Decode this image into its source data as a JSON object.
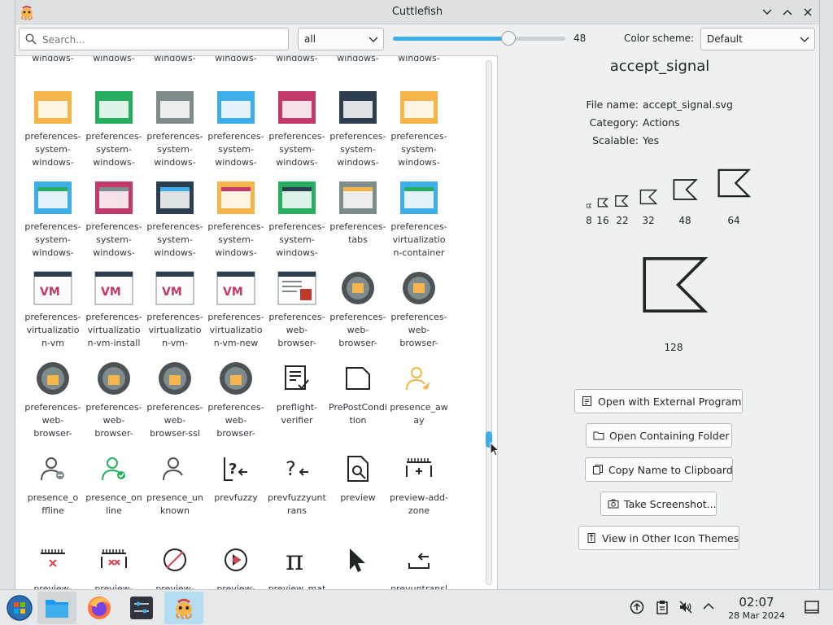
{
  "window": {
    "title": "Cuttlefish"
  },
  "toolbar": {
    "search_placeholder": "Search...",
    "filter_value": "all",
    "zoom_value": "48",
    "zoom_fraction": 0.67,
    "color_scheme_label": "Color scheme:",
    "color_scheme_value": "Default"
  },
  "grid": {
    "rows": [
      [
        "system-\nwindows-",
        "system-\nwindows-",
        "system-\nwindows-",
        "system-\nwindows-",
        "system-\nwindows-",
        "system-\nwindows-",
        "system-\nwindows-"
      ],
      [
        "preferences-\nsystem-\nwindows-",
        "preferences-\nsystem-\nwindows-",
        "preferences-\nsystem-\nwindows-",
        "preferences-\nsystem-\nwindows-",
        "preferences-\nsystem-\nwindows-",
        "preferences-\nsystem-\nwindows-",
        "preferences-\nsystem-\nwindows-"
      ],
      [
        "preferences-\nsystem-\nwindows-",
        "preferences-\nsystem-\nwindows-",
        "preferences-\nsystem-\nwindows-",
        "preferences-\nsystem-\nwindows-",
        "preferences-\nsystem-\nwindows-",
        "preferences-\ntabs",
        "preferences-\nvirtualizatio\nn-container"
      ],
      [
        "preferences-\nvirtualizatio\nn-vm",
        "preferences-\nvirtualizatio\nn-vm-install",
        "preferences-\nvirtualizatio\nn-vm-",
        "preferences-\nvirtualizatio\nn-vm-new",
        "preferences-\nweb-\nbrowser-",
        "preferences-\nweb-\nbrowser-",
        "preferences-\nweb-\nbrowser-"
      ],
      [
        "preferences-\nweb-\nbrowser-",
        "preferences-\nweb-\nbrowser-",
        "preferences-\nweb-\nbrowser-ssl",
        "preferences-\nweb-\nbrowser-",
        "preflight-\nverifier",
        "PrePostCondi\ntion",
        "presence_aw\nay"
      ],
      [
        "presence_o\nffline",
        "presence_on\nline",
        "presence_un\nknown",
        "prevfuzzy",
        "prevfuzzyunt\nrans",
        "preview",
        "preview-add-\nzone"
      ],
      [
        "preview-",
        "preview-",
        "preview-",
        "preview-",
        "preview_mat",
        "",
        "prevuntransl"
      ]
    ]
  },
  "details": {
    "icon_name": "accept_signal",
    "file_name_label": "File name:",
    "file_name_value": "accept_signal.svg",
    "category_label": "Category:",
    "category_value": "Actions",
    "scalable_label": "Scalable:",
    "scalable_value": "Yes",
    "sizes": [
      "8",
      "16",
      "22",
      "32",
      "48",
      "64",
      "128"
    ],
    "buttons": {
      "open_external": "Open with External Program",
      "open_folder": "Open Containing Folder",
      "copy_name": "Copy Name to Clipboard",
      "screenshot": "Take Screenshot...",
      "other_themes": "View in Other Icon Themes"
    }
  },
  "taskbar": {
    "time": "02:07",
    "date": "28 Mar 2024"
  },
  "colors": {
    "accent": "#3daee9",
    "pinkish": "#c23a6b",
    "dark_icon": "#232627"
  }
}
